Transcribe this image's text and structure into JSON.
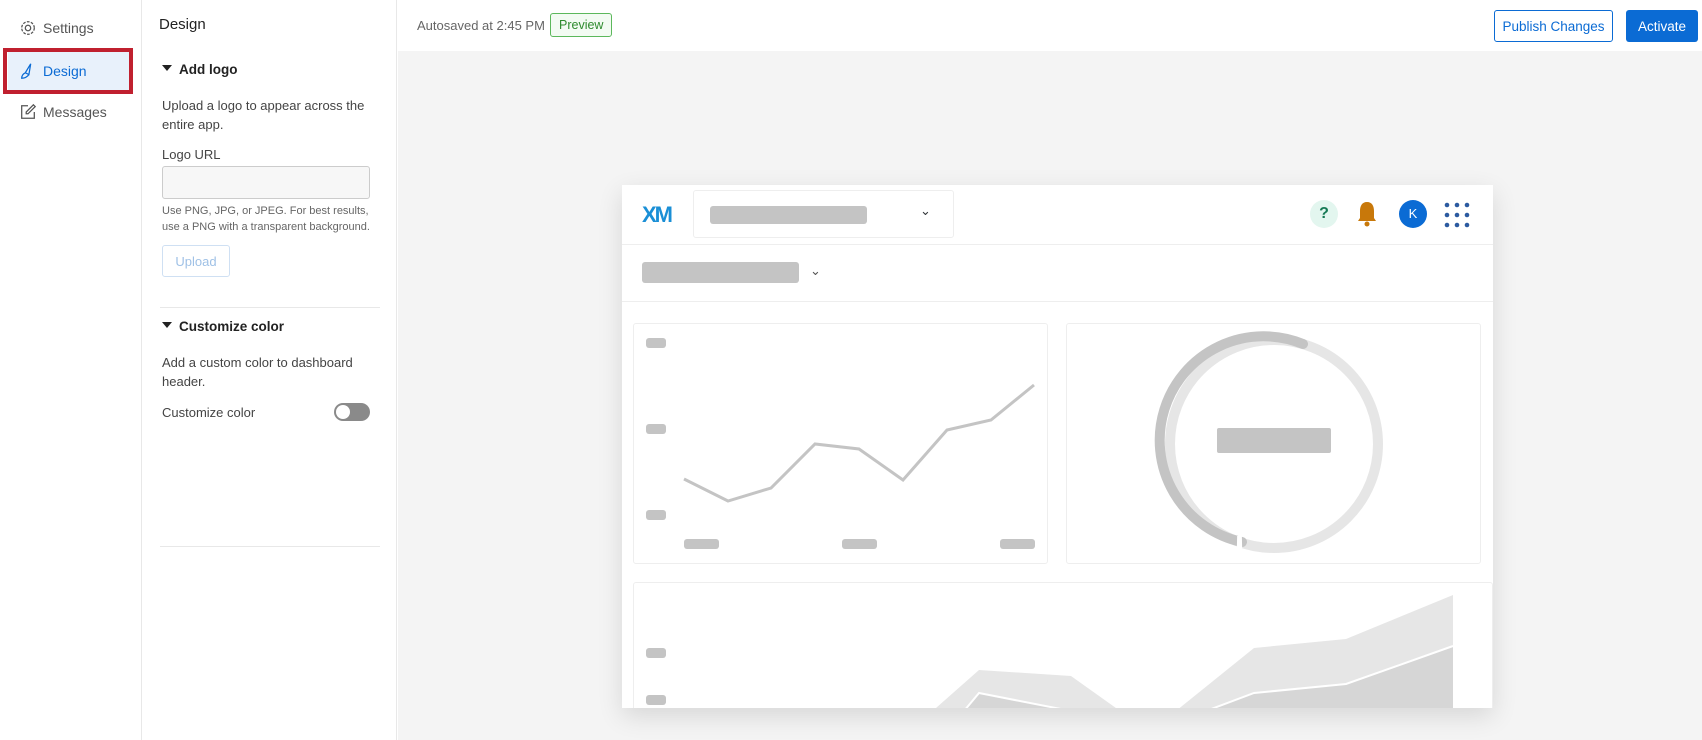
{
  "nav": {
    "items": [
      {
        "label": "Settings",
        "icon": "gear-icon"
      },
      {
        "label": "Design",
        "icon": "brush-icon"
      },
      {
        "label": "Messages",
        "icon": "edit-icon"
      }
    ]
  },
  "panel": {
    "title": "Design",
    "add_logo": {
      "heading": "Add logo",
      "description": "Upload a logo to appear across the entire app.",
      "field_label": "Logo URL",
      "field_value": "",
      "hint": "Use PNG, JPG, or JPEG. For best results, use a PNG with a transparent background.",
      "upload_label": "Upload"
    },
    "customize_color": {
      "heading": "Customize color",
      "description": "Add a custom color to dashboard header.",
      "toggle_label": "Customize color",
      "toggle_on": false
    }
  },
  "topbar": {
    "autosave": "Autosaved at 2:45 PM",
    "preview": "Preview",
    "publish": "Publish Changes",
    "activate": "Activate"
  },
  "preview_card": {
    "logo": "XM",
    "avatar_initial": "K",
    "help": "?"
  },
  "colors": {
    "accent": "#0b6bd4",
    "highlight": "#c0202f",
    "bell": "#c8780a"
  }
}
